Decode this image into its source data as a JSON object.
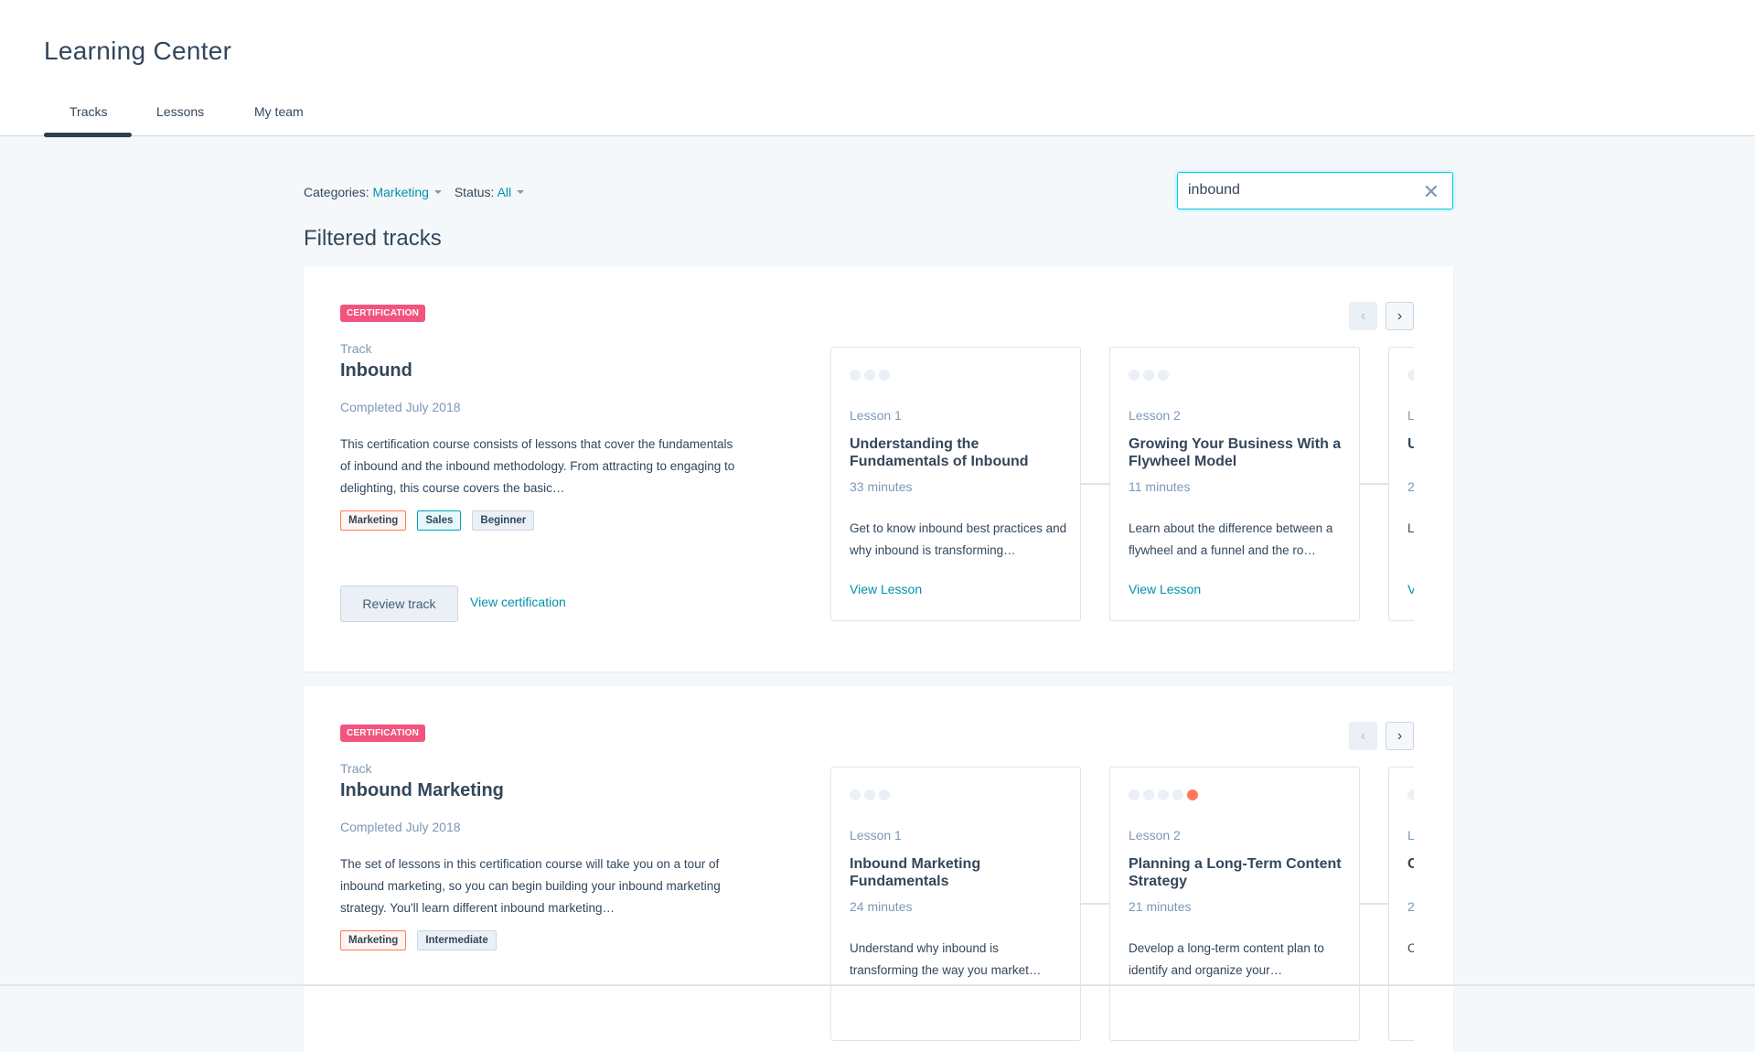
{
  "header": {
    "title": "Learning Center",
    "tabs": [
      {
        "label": "Tracks",
        "active": true
      },
      {
        "label": "Lessons"
      },
      {
        "label": "My team"
      }
    ]
  },
  "filters": {
    "categories_label": "Categories:",
    "categories_value": "Marketing",
    "status_label": "Status:",
    "status_value": "All"
  },
  "search": {
    "value": "inbound",
    "clear_icon": "close-icon"
  },
  "section_title": "Filtered tracks",
  "colors": {
    "accent": "#0091ae",
    "badge": "#f2547d",
    "progress": "#ff7a59",
    "focus": "#00d0e4"
  },
  "tracks": [
    {
      "badge": "CERTIFICATION",
      "label": "Track",
      "name": "Inbound",
      "status": "Completed July 2018",
      "description": "This certification course consists of lessons that cover the fundamentals of inbound and the inbound methodology. From attracting to engaging to delighting, this course covers the basic…",
      "tags": [
        {
          "text": "Marketing",
          "style": "orange"
        },
        {
          "text": "Sales",
          "style": "teal"
        },
        {
          "text": "Beginner",
          "style": "gray"
        }
      ],
      "review_button": "Review track",
      "view_link": "View certification",
      "lessons": [
        {
          "label": "Lesson 1",
          "title": "Understanding the Fundamentals of Inbound",
          "duration": "33 minutes",
          "description": "Get to know inbound best practices and why inbound is transforming…",
          "link": "View Lesson",
          "dots": 3,
          "active_dot": -1
        },
        {
          "label": "Lesson 2",
          "title": "Growing Your Business With a Flywheel Model",
          "duration": "11 minutes",
          "description": "Learn about the difference between a flywheel and a funnel and the ro…",
          "link": "View Lesson",
          "dots": 3,
          "active_dot": -1
        },
        {
          "label": "Le",
          "title": "U P",
          "duration": "2",
          "description": "Le th",
          "link": "V",
          "dots": 1,
          "active_dot": -1
        }
      ]
    },
    {
      "badge": "CERTIFICATION",
      "label": "Track",
      "name": "Inbound Marketing",
      "status": "Completed July 2018",
      "description": "The set of lessons in this certification course will take you on a tour of inbound marketing, so you can begin building your inbound marketing strategy. You'll learn different inbound marketing…",
      "tags": [
        {
          "text": "Marketing",
          "style": "orange"
        },
        {
          "text": "Intermediate",
          "style": "gray"
        }
      ],
      "lessons": [
        {
          "label": "Lesson 1",
          "title": "Inbound Marketing Fundamentals",
          "duration": "24 minutes",
          "description": "Understand why inbound is transforming the way you market…",
          "dots": 3,
          "active_dot": -1
        },
        {
          "label": "Lesson 2",
          "title": "Planning a Long-Term Content Strategy",
          "duration": "21 minutes",
          "description": "Develop a long-term content plan to identify and organize your…",
          "dots": 5,
          "active_dot": 4
        },
        {
          "label": "Le",
          "title": "C",
          "duration": "2",
          "description": "C fc",
          "dots": 1,
          "active_dot": -1
        }
      ]
    }
  ]
}
